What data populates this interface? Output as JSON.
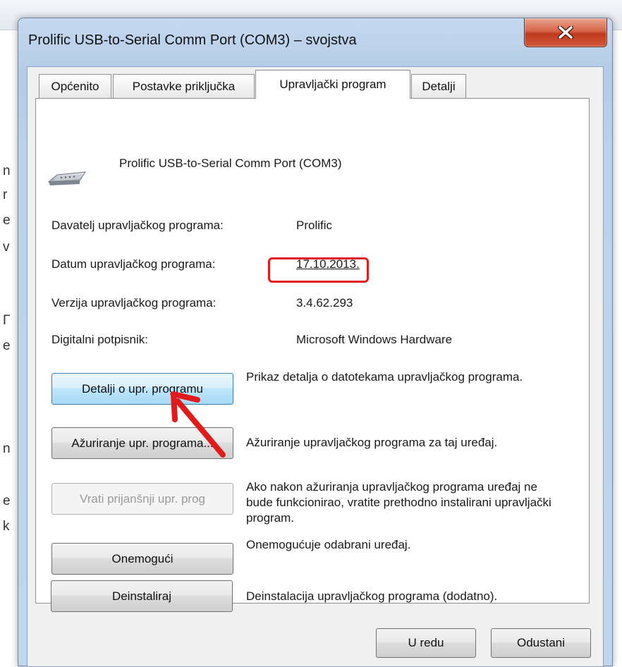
{
  "background": {
    "letters": [
      "n",
      "r",
      "e",
      "v",
      "Γ",
      "e",
      "n",
      "e",
      "k"
    ]
  },
  "dialog": {
    "title": "Prolific USB-to-Serial Comm Port (COM3) – svojstva",
    "close_icon": "close-x-icon",
    "tabs": [
      {
        "label": "Općenito",
        "active": false
      },
      {
        "label": "Postavke priključka",
        "active": false
      },
      {
        "label": "Upravljački program",
        "active": true
      },
      {
        "label": "Detalji",
        "active": false
      }
    ],
    "device": {
      "icon": "serial-port-icon",
      "name": "Prolific USB-to-Serial Comm Port (COM3)"
    },
    "properties": {
      "provider_label": "Davatelj upravljačkog programa:",
      "provider_value": "Prolific",
      "date_label": "Datum upravljačkog programa:",
      "date_value": "17.10.2013.",
      "version_label": "Verzija upravljačkog programa:",
      "version_value": "3.4.62.293",
      "signer_label": "Digitalni potpisnik:",
      "signer_value": "Microsoft Windows Hardware"
    },
    "actions": {
      "details_button": "Detalji o upr. programu",
      "details_desc": "Prikaz detalja o datotekama upravljačkog programa.",
      "update_button": "Ažuriranje upr. programa...",
      "update_desc": "Ažuriranje upravljačkog programa za taj uređaj.",
      "rollback_button": "Vrati prijanšnji upr. prog",
      "rollback_desc": "Ako nakon ažuriranja upravljačkog programa uređaj ne bude funkcionirao, vratite prethodno instalirani upravljački program.",
      "disable_button": "Onemogući",
      "disable_desc": "Onemogućuje odabrani uređaj.",
      "uninstall_button": "Deinstaliraj",
      "uninstall_desc": "Deinstalacija upravljačkog programa (dodatno)."
    },
    "footer": {
      "ok_button": "U redu",
      "cancel_button": "Odustani"
    },
    "annotations": {
      "highlight_color": "#e11b1b",
      "arrow_color": "#e11b1b"
    }
  }
}
